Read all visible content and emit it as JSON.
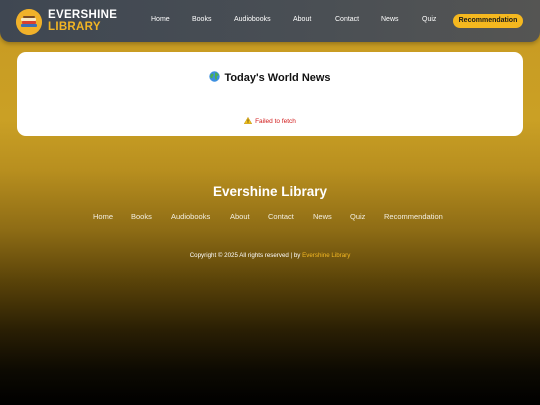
{
  "header": {
    "brand_top": "EVERSHINE",
    "brand_bottom": "LIBRARY",
    "logo_icon": "books-icon",
    "nav": [
      "Home",
      "Books",
      "Audiobooks",
      "About",
      "Contact",
      "News",
      "Quiz"
    ],
    "cta_label": "Recommendation"
  },
  "news": {
    "title": "Today's World News",
    "title_icon": "globe-icon",
    "error_icon": "warning-icon",
    "error_text": "Failed to fetch"
  },
  "footer": {
    "title": "Evershine Library",
    "links": [
      "Home",
      "Books",
      "Audiobooks",
      "About",
      "Contact",
      "News",
      "Quiz",
      "Recommendation"
    ],
    "copyright_prefix": "Copyright © 2025 All rights reserved | by ",
    "copyright_brand": "Evershine Library"
  },
  "colors": {
    "accent": "#f5b81f",
    "error": "#d11a1a",
    "nav_bg": "#454b52"
  }
}
